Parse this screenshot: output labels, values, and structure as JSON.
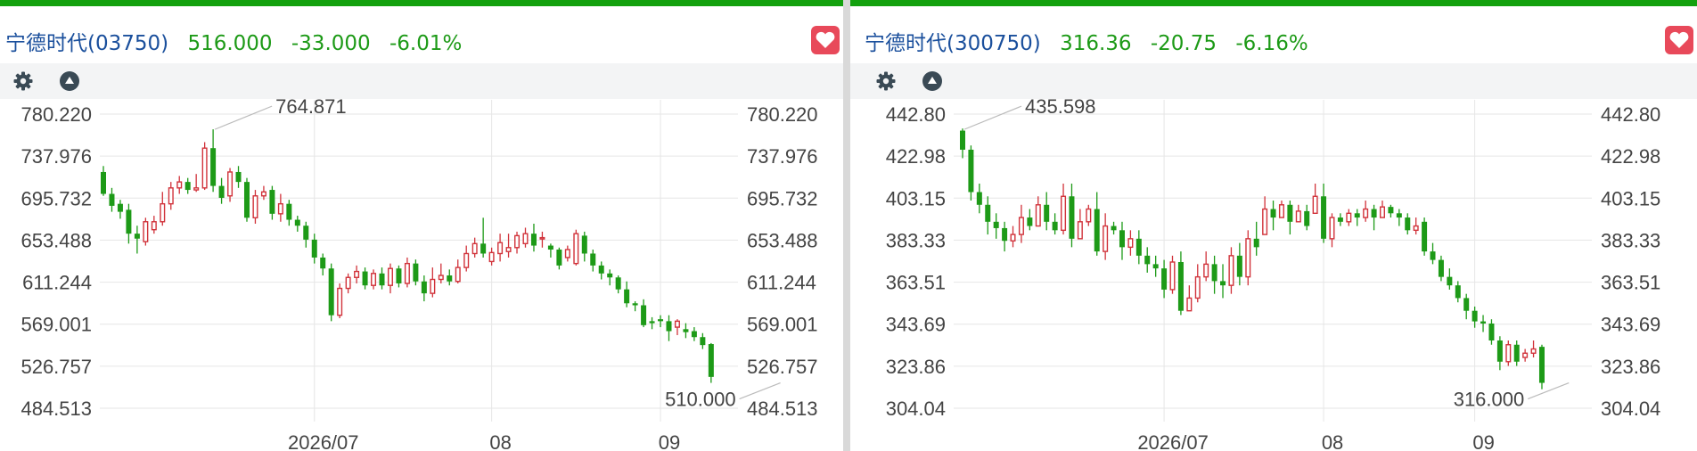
{
  "colors": {
    "accent_green": "#13a10e",
    "up": "#d1323a",
    "down": "#1d9a17",
    "name_blue": "#1a4f9c",
    "price_green": "#1d9a17",
    "fav_red": "#e8495a",
    "grid": "#e6e6e6",
    "label": "#444444"
  },
  "panels": [
    {
      "name": "宁德时代(03750)",
      "price": "516.000",
      "change": "-33.000",
      "change_pct": "-6.01%",
      "toolbar": {
        "settings_icon": "gear-icon",
        "collapse_icon": "triangle-up-icon"
      },
      "fav_icon": "heart-icon"
    },
    {
      "name": "宁德时代(300750)",
      "price": "316.36",
      "change": "-20.75",
      "change_pct": "-6.16%",
      "toolbar": {
        "settings_icon": "gear-icon",
        "collapse_icon": "triangle-up-icon"
      },
      "fav_icon": "heart-icon"
    }
  ],
  "chart_data": [
    {
      "type": "candlestick",
      "y_ticks": [
        "780.220",
        "737.976",
        "695.732",
        "653.488",
        "611.244",
        "569.001",
        "526.757",
        "484.513"
      ],
      "ylim": [
        484.513,
        780.22
      ],
      "x_ticks": [
        {
          "label": "2026/07",
          "index": 25
        },
        {
          "label": "08",
          "index": 46
        },
        {
          "label": "09",
          "index": 66
        }
      ],
      "annotations": [
        {
          "label": "764.871",
          "index": 13,
          "value": 764.871
        },
        {
          "label": "510.000",
          "index": 80,
          "value": 510.0
        }
      ],
      "candles": [
        [
          722,
          700,
          728,
          698
        ],
        [
          700,
          688,
          706,
          682
        ],
        [
          690,
          682,
          694,
          675
        ],
        [
          684,
          660,
          690,
          650
        ],
        [
          660,
          655,
          668,
          640
        ],
        [
          652,
          672,
          676,
          648
        ],
        [
          664,
          672,
          678,
          660
        ],
        [
          672,
          690,
          702,
          668
        ],
        [
          690,
          706,
          712,
          684
        ],
        [
          706,
          712,
          718,
          700
        ],
        [
          712,
          704,
          716,
          700
        ],
        [
          704,
          706,
          720,
          702
        ],
        [
          706,
          746,
          752,
          704
        ],
        [
          746,
          708,
          764.9,
          702
        ],
        [
          708,
          696,
          716,
          690
        ],
        [
          698,
          722,
          726,
          692
        ],
        [
          722,
          712,
          728,
          706
        ],
        [
          712,
          676,
          716,
          672
        ],
        [
          676,
          698,
          704,
          670
        ],
        [
          698,
          702,
          708,
          694
        ],
        [
          704,
          680,
          708,
          674
        ],
        [
          680,
          690,
          700,
          672
        ],
        [
          690,
          674,
          694,
          668
        ],
        [
          674,
          668,
          678,
          662
        ],
        [
          668,
          654,
          672,
          646
        ],
        [
          654,
          636,
          660,
          630
        ],
        [
          636,
          625,
          640,
          618
        ],
        [
          625,
          578,
          630,
          572
        ],
        [
          578,
          605,
          610,
          575
        ],
        [
          605,
          616,
          620,
          600
        ],
        [
          616,
          622,
          628,
          610
        ],
        [
          622,
          608,
          626,
          604
        ],
        [
          608,
          620,
          624,
          604
        ],
        [
          620,
          608,
          626,
          604
        ],
        [
          608,
          625,
          630,
          600
        ],
        [
          625,
          610,
          628,
          606
        ],
        [
          610,
          630,
          636,
          606
        ],
        [
          630,
          612,
          634,
          608
        ],
        [
          612,
          600,
          618,
          592
        ],
        [
          600,
          614,
          626,
          596
        ],
        [
          614,
          618,
          630,
          610
        ],
        [
          618,
          612,
          624,
          608
        ],
        [
          612,
          626,
          634,
          610
        ],
        [
          626,
          640,
          648,
          622
        ],
        [
          640,
          650,
          656,
          636
        ],
        [
          650,
          640,
          676,
          636
        ],
        [
          632,
          641,
          646,
          628
        ],
        [
          640,
          651,
          660,
          632
        ],
        [
          642,
          646,
          660,
          636
        ],
        [
          646,
          658,
          662,
          640
        ],
        [
          650,
          660,
          666,
          646
        ],
        [
          660,
          648,
          670,
          642
        ],
        [
          656,
          656,
          662,
          646
        ],
        [
          648,
          644,
          650,
          636
        ],
        [
          644,
          628,
          646,
          624
        ],
        [
          636,
          644,
          648,
          632
        ],
        [
          630,
          660,
          664,
          628
        ],
        [
          658,
          640,
          662,
          632
        ],
        [
          640,
          628,
          644,
          622
        ],
        [
          628,
          620,
          632,
          614
        ],
        [
          620,
          616,
          624,
          608
        ],
        [
          616,
          604,
          618,
          600
        ],
        [
          604,
          590,
          612,
          586
        ],
        [
          590,
          588,
          592,
          582
        ],
        [
          588,
          568,
          594,
          566
        ],
        [
          572,
          570,
          576,
          564
        ],
        [
          574,
          572,
          578,
          566
        ],
        [
          572,
          562,
          578,
          552
        ],
        [
          566,
          572,
          574,
          558
        ],
        [
          564,
          561,
          570,
          555
        ],
        [
          562,
          556,
          566,
          552
        ],
        [
          556,
          548,
          560,
          544
        ],
        [
          549,
          516,
          550,
          510
        ]
      ]
    },
    {
      "type": "candlestick",
      "y_ticks": [
        "442.80",
        "422.98",
        "403.15",
        "383.33",
        "363.51",
        "343.69",
        "323.86",
        "304.04"
      ],
      "ylim": [
        304.04,
        442.8
      ],
      "x_ticks": [
        {
          "label": "2026/07",
          "index": 24
        },
        {
          "label": "08",
          "index": 43
        },
        {
          "label": "09",
          "index": 61
        }
      ],
      "annotations": [
        {
          "label": "435.598",
          "index": 0,
          "value": 435.598
        },
        {
          "label": "316.000",
          "index": 72,
          "value": 316.0
        }
      ],
      "candles": [
        [
          435,
          426,
          436,
          422
        ],
        [
          426,
          406,
          428,
          402
        ],
        [
          406,
          400,
          410,
          396
        ],
        [
          400,
          392,
          404,
          386
        ],
        [
          392,
          389,
          396,
          384
        ],
        [
          389,
          383,
          392,
          378
        ],
        [
          383,
          386,
          390,
          380
        ],
        [
          386,
          394,
          400,
          382
        ],
        [
          394,
          390,
          398,
          388
        ],
        [
          390,
          400,
          404,
          390
        ],
        [
          400,
          392,
          406,
          388
        ],
        [
          392,
          388,
          396,
          386
        ],
        [
          388,
          404,
          410,
          386
        ],
        [
          404,
          384,
          410,
          380
        ],
        [
          384,
          392,
          398,
          386
        ],
        [
          392,
          398,
          400,
          390
        ],
        [
          398,
          378,
          406,
          376
        ],
        [
          378,
          390,
          396,
          374
        ],
        [
          390,
          388,
          392,
          386
        ],
        [
          388,
          380,
          392,
          374
        ],
        [
          380,
          384,
          388,
          376
        ],
        [
          384,
          376,
          388,
          372
        ],
        [
          376,
          372,
          380,
          368
        ],
        [
          372,
          370,
          376,
          366
        ],
        [
          370,
          360,
          374,
          356
        ],
        [
          360,
          373,
          376,
          358
        ],
        [
          373,
          350,
          378,
          348
        ],
        [
          350,
          356,
          362,
          350
        ],
        [
          356,
          366,
          372,
          354
        ],
        [
          366,
          372,
          378,
          364
        ],
        [
          372,
          364,
          376,
          358
        ],
        [
          364,
          362,
          372,
          356
        ],
        [
          362,
          376,
          380,
          358
        ],
        [
          376,
          366,
          382,
          362
        ],
        [
          366,
          384,
          388,
          362
        ],
        [
          384,
          380,
          392,
          376
        ],
        [
          386,
          398,
          404,
          392
        ],
        [
          398,
          394,
          402,
          388
        ],
        [
          394,
          400,
          402,
          394
        ],
        [
          400,
          392,
          402,
          386
        ],
        [
          392,
          397,
          400,
          392
        ],
        [
          397,
          390,
          400,
          388
        ],
        [
          396,
          404,
          410,
          398
        ],
        [
          404,
          384,
          410,
          382
        ],
        [
          384,
          394,
          396,
          380
        ],
        [
          394,
          392,
          396,
          390
        ],
        [
          392,
          396,
          398,
          390
        ],
        [
          396,
          394,
          398,
          390
        ],
        [
          394,
          398,
          402,
          392
        ],
        [
          398,
          394,
          400,
          388
        ],
        [
          394,
          399,
          402,
          394
        ],
        [
          399,
          396,
          400,
          394
        ],
        [
          396,
          394,
          398,
          390
        ],
        [
          394,
          388,
          396,
          386
        ],
        [
          388,
          390,
          394,
          386
        ],
        [
          392,
          378,
          394,
          376
        ],
        [
          378,
          374,
          382,
          372
        ],
        [
          374,
          366,
          376,
          364
        ],
        [
          366,
          362,
          370,
          360
        ],
        [
          362,
          356,
          364,
          354
        ],
        [
          356,
          350,
          358,
          346
        ],
        [
          350,
          345,
          352,
          342
        ],
        [
          345,
          344,
          348,
          340
        ],
        [
          344,
          336,
          346,
          334
        ],
        [
          336,
          326,
          338,
          322
        ],
        [
          326,
          334,
          336,
          324
        ],
        [
          334,
          326,
          336,
          324
        ],
        [
          328,
          330,
          332,
          326
        ],
        [
          330,
          332,
          336,
          328
        ],
        [
          333,
          316,
          334,
          313
        ]
      ]
    }
  ]
}
